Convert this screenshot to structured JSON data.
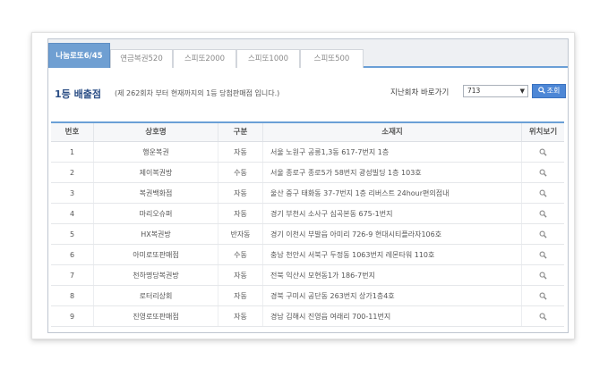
{
  "tabs": [
    {
      "label": "나눔로또6/45",
      "active": true
    },
    {
      "label": "연금복권520",
      "active": false
    },
    {
      "label": "스피또2000",
      "active": false
    },
    {
      "label": "스피또1000",
      "active": false
    },
    {
      "label": "스피또500",
      "active": false
    }
  ],
  "header": {
    "title": "1등 배출점",
    "subtitle": "(제 262회차 부터 현재까지의 1등 당첨판매점 입니다.)",
    "jump_label": "지난회차 바로가기",
    "round_value": "713",
    "search_label": "조회"
  },
  "table": {
    "columns": [
      "번호",
      "상호명",
      "구분",
      "소재지",
      "위치보기"
    ],
    "rows": [
      {
        "no": "1",
        "name": "행운복권",
        "type": "자동",
        "address": "서울 노원구 공릉1,3동 617-7번지 1층"
      },
      {
        "no": "2",
        "name": "제이복권방",
        "type": "수동",
        "address": "서울 종로구 종로5가 58번지 광성빌딩 1층 103호"
      },
      {
        "no": "3",
        "name": "복권백화점",
        "type": "자동",
        "address": "울산 중구 태화동 37-7번지 1층 리버스트 24hour편의점내"
      },
      {
        "no": "4",
        "name": "마리오슈퍼",
        "type": "자동",
        "address": "경기 부천시 소사구 심곡본동 675-1번지"
      },
      {
        "no": "5",
        "name": "HX복권방",
        "type": "반자동",
        "address": "경기 이천시 부발읍 아미리 726-9 현대시티플라자106호"
      },
      {
        "no": "6",
        "name": "아미로또판매점",
        "type": "수동",
        "address": "충남 천안시 서북구 두정동 1063번지 레몬타워 110호"
      },
      {
        "no": "7",
        "name": "천하명당복권방",
        "type": "자동",
        "address": "전북 익산시 모현동1가 186-7번지"
      },
      {
        "no": "8",
        "name": "로터리상회",
        "type": "자동",
        "address": "경북 구미시 공단동 263번지 상가1층4호"
      },
      {
        "no": "9",
        "name": "진영로또판매점",
        "type": "자동",
        "address": "경남 김해시 진영읍 여래리 700-11번지"
      }
    ]
  },
  "colors": {
    "accent": "#6f9fd2",
    "title": "#2c4f86",
    "button": "#4d87d6"
  },
  "icons": {
    "search": "magnifier-icon",
    "location": "magnifier-icon"
  }
}
